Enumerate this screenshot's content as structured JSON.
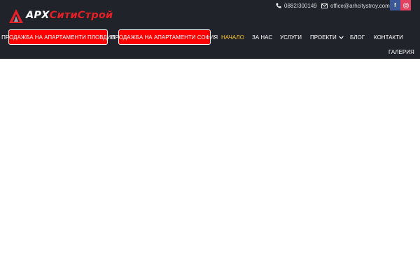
{
  "logo": {
    "part1": "АРХ",
    "part2": "СитиСтрой",
    "accent_color": "#e41f26"
  },
  "contact": {
    "phone_icon": "phone-icon",
    "phone": "0882/300149",
    "email_icon": "envelope-icon",
    "email": "office@arhcitystroy.com"
  },
  "social": {
    "facebook": {
      "icon": "facebook-icon",
      "glyph": "f",
      "color": "#3b5998"
    },
    "instagram": {
      "icon": "instagram-icon",
      "color": "#e4405f"
    }
  },
  "cta_buttons": [
    {
      "label": "ПРОДАЖБА НА АПАРТАМЕНТИ ПЛОВДИВ"
    },
    {
      "label": "ПРОДАЖБА НА АПАРТАМЕНТИ СОФИЯ"
    }
  ],
  "nav": {
    "items": [
      {
        "label": "НАЧАЛО",
        "active": true
      },
      {
        "label": "ЗА НАС"
      },
      {
        "label": "УСЛУГИ"
      },
      {
        "label": "ПРОЕКТИ",
        "has_dropdown": true
      },
      {
        "label": "БЛОГ"
      },
      {
        "label": "КОНТАКТИ"
      },
      {
        "label": "ГАЛЕРИЯ"
      }
    ],
    "active_color": "#f4c22b"
  },
  "colors": {
    "header_bg": "#21232b",
    "cta_bg": "#ff0000",
    "page_bg": "#ffffff"
  }
}
